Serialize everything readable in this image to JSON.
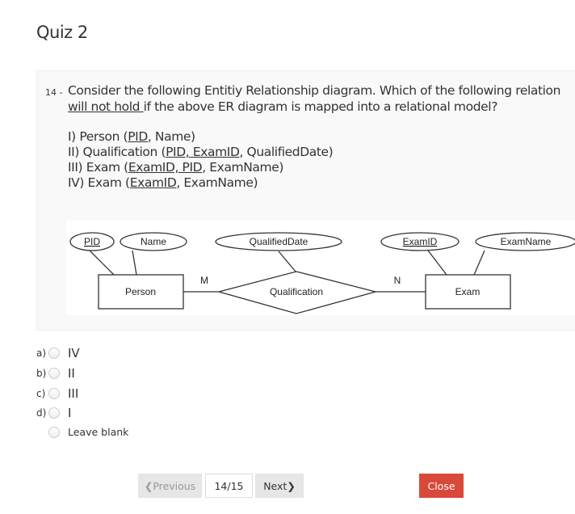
{
  "page_title": "Quiz 2",
  "question": {
    "number": "14 -",
    "line1": "Consider the following Entitiy Relationship diagram. Which of the following relation",
    "line2_underlined": "will not hold ",
    "line2_rest": "if the above ER diagram is mapped into a relational model?",
    "relations": [
      {
        "prefix": "I) Person (",
        "keys": "PID",
        "rest": ", Name)"
      },
      {
        "prefix": "II) Qualification (",
        "keys": "PID, ExamID",
        "rest": ", QualifiedDate)"
      },
      {
        "prefix": "III) Exam (",
        "keys": "ExamID, PID",
        "rest": ", ExamName)"
      },
      {
        "prefix": "IV) Exam (",
        "keys": "ExamID",
        "rest": ", ExamName)"
      }
    ]
  },
  "diagram": {
    "attributes": [
      "PID",
      "Name",
      "QualifiedDate",
      "ExamID",
      "ExamName"
    ],
    "entities": [
      "Person",
      "Exam"
    ],
    "relationship": "Qualification",
    "cardinality_left": "M",
    "cardinality_right": "N"
  },
  "options": [
    {
      "letter": "a)",
      "text": "IV"
    },
    {
      "letter": "b)",
      "text": "II"
    },
    {
      "letter": "c)",
      "text": "III"
    },
    {
      "letter": "d)",
      "text": "I"
    },
    {
      "letter": "",
      "text": "Leave blank"
    }
  ],
  "nav": {
    "previous": "Previous",
    "page": "14/15",
    "next": "Next",
    "close": "Close"
  },
  "colors": {
    "close_button": "#d9493a",
    "nav_button": "#e6e6e6"
  }
}
